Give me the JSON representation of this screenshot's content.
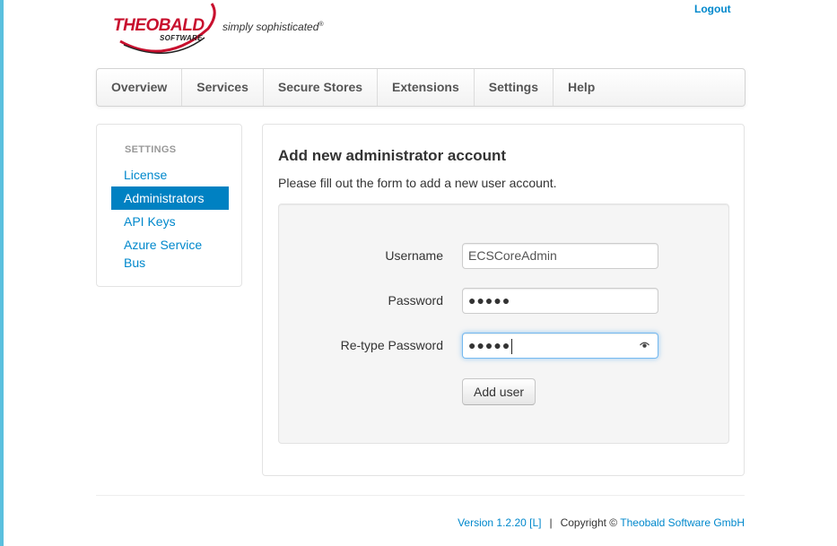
{
  "header": {
    "logo_word": "THEOBALD",
    "logo_sub": "SOFTWARE",
    "tagline": "simply sophisticated",
    "tagline_mark": "®",
    "logout_label": "Logout"
  },
  "nav": {
    "items": [
      {
        "label": "Overview"
      },
      {
        "label": "Services"
      },
      {
        "label": "Secure Stores"
      },
      {
        "label": "Extensions"
      },
      {
        "label": "Settings"
      },
      {
        "label": "Help"
      }
    ]
  },
  "sidebar": {
    "header": "SETTINGS",
    "items": [
      {
        "label": "License",
        "active": false
      },
      {
        "label": "Administrators",
        "active": true
      },
      {
        "label": "API Keys",
        "active": false
      },
      {
        "label": "Azure Service Bus",
        "active": false
      }
    ]
  },
  "form": {
    "title": "Add new administrator account",
    "description": "Please fill out the form to add a new user account.",
    "username_label": "Username",
    "username_value": "ECSCoreAdmin",
    "password_label": "Password",
    "password_value": "●●●●●",
    "retype_label": "Re-type Password",
    "retype_value": "●●●●●",
    "retype_icon": "eye-icon",
    "submit_label": "Add user"
  },
  "footer": {
    "version": "Version 1.2.20 [L]",
    "separator": "|",
    "copyright_prefix": "Copyright ©",
    "company": "Theobald Software GmbH"
  },
  "colors": {
    "link": "#0088cc",
    "active_bg": "#0081c2",
    "brand_red": "#c8102e",
    "stripe": "#5bc0de"
  }
}
